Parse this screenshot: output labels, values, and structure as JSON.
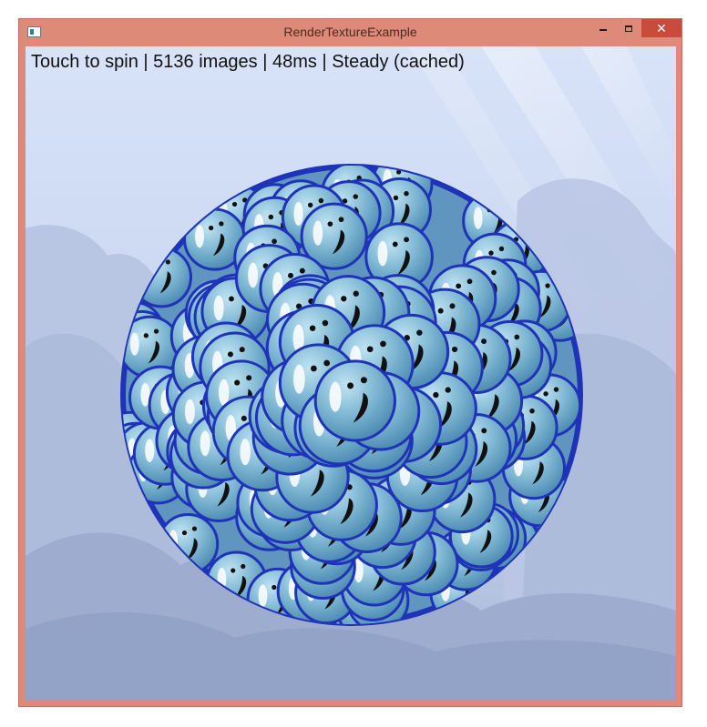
{
  "window": {
    "title": "RenderTextureExample",
    "minimize_glyph": "minimize-icon",
    "maximize_glyph": "maximize-icon",
    "close_label": "✕"
  },
  "hud": {
    "status_text": "Touch to spin | 5136 images | 48ms | Steady (cached)"
  },
  "colors": {
    "window_frame": "#dd8a78",
    "close_button": "#c84b3c",
    "sky_top": "#d6e1f7",
    "sky_bottom": "#a8b8d6",
    "bubble_fill": "#7fb7d3",
    "bubble_outline": "#1f33b8"
  }
}
